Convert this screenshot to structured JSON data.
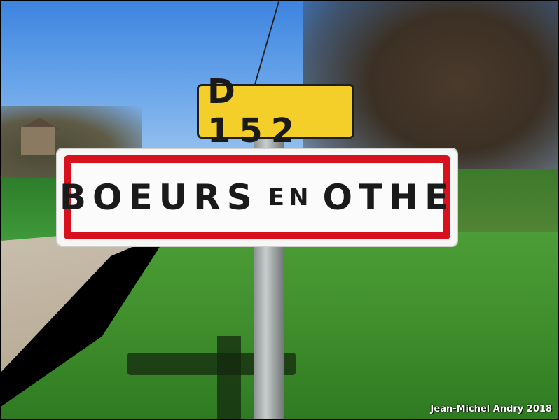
{
  "route_sign": {
    "number": "D 152"
  },
  "town_sign": {
    "name_first": "BOEURS",
    "name_join": "EN",
    "name_last": "OTHE"
  },
  "credit": "Jean-Michel Andry 2018",
  "colors": {
    "route_sign_bg": "#f4cf2a",
    "town_sign_border": "#d7121e",
    "sky": "#3d84e0",
    "grass": "#3f8e2c"
  }
}
